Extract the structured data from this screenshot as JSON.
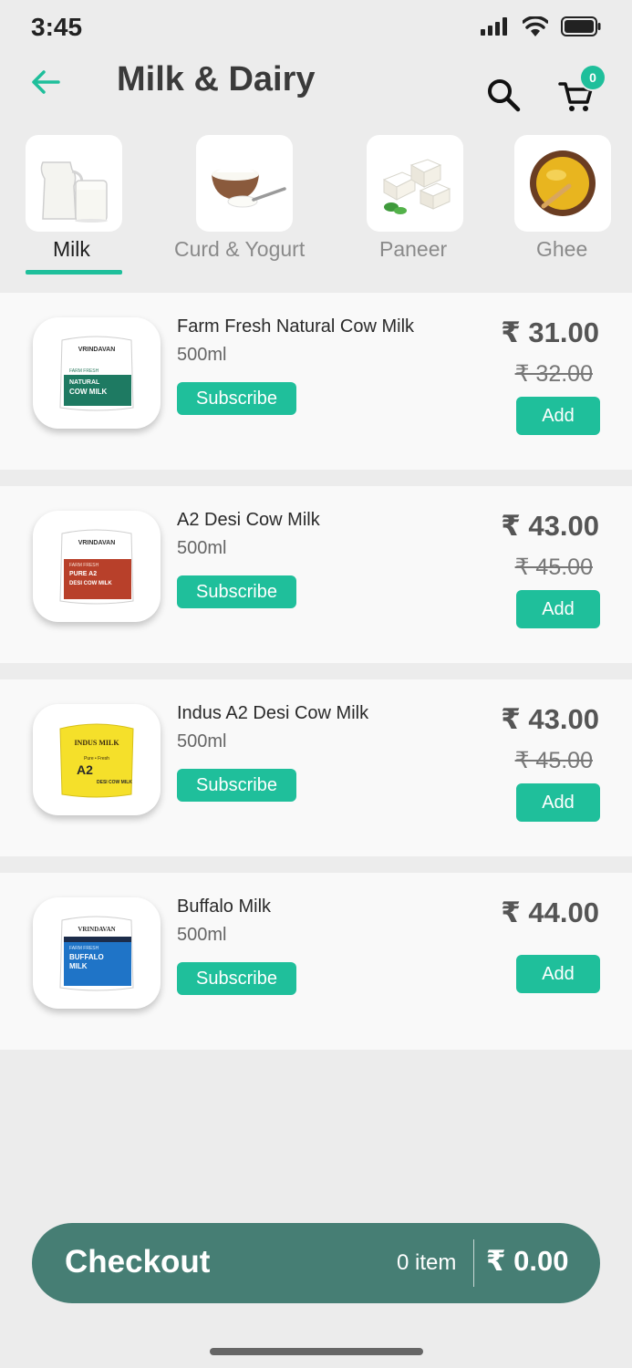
{
  "status_bar": {
    "time": "3:45"
  },
  "header": {
    "title": "Milk & Dairy",
    "cart_count": "0"
  },
  "categories": [
    {
      "label": "Milk",
      "icon": "milk-jug-and-glass",
      "active": true
    },
    {
      "label": "Curd & Yogurt",
      "icon": "curd-bowl-with-spoon",
      "active": false
    },
    {
      "label": "Paneer",
      "icon": "paneer-cubes",
      "active": false
    },
    {
      "label": "Ghee",
      "icon": "ghee-bowl",
      "active": false
    }
  ],
  "products": [
    {
      "name": "Farm Fresh Natural Cow Milk",
      "size": "500ml",
      "price": "₹ 31.00",
      "mrp": "₹ 32.00",
      "subscribe_label": "Subscribe",
      "add_label": "Add",
      "pack": {
        "brand": "VRINDAVAN",
        "line1": "FARM FRESH",
        "line2": "NATURAL",
        "line3": "COW MILK",
        "color": "#1e7a62"
      }
    },
    {
      "name": "A2 Desi Cow Milk",
      "size": "500ml",
      "price": "₹ 43.00",
      "mrp": "₹ 45.00",
      "subscribe_label": "Subscribe",
      "add_label": "Add",
      "pack": {
        "brand": "VRINDAVAN",
        "line1": "FARM FRESH",
        "line2": "PURE A2",
        "line3": "DESI COW MILK",
        "color": "#b8402a"
      }
    },
    {
      "name": "Indus A2 Desi Cow Milk",
      "size": "500ml",
      "price": "₹ 43.00",
      "mrp": "₹ 45.00",
      "subscribe_label": "Subscribe",
      "add_label": "Add",
      "pack": {
        "brand": "INDUS MILK",
        "line1": "Pure • Fresh",
        "line2": "A2",
        "line3": "DESI COW MILK",
        "color": "#f5e02a"
      }
    },
    {
      "name": "Buffalo Milk",
      "size": "500ml",
      "price": "₹ 44.00",
      "mrp": "",
      "subscribe_label": "Subscribe",
      "add_label": "Add",
      "pack": {
        "brand": "VRINDAVAN",
        "line1": "FARM FRESH",
        "line2": "BUFFALO",
        "line3": "MILK",
        "color": "#1f74c7"
      }
    }
  ],
  "checkout": {
    "label": "Checkout",
    "count": "0 item",
    "total": "₹ 0.00"
  },
  "colors": {
    "accent": "#1fbf9b",
    "checkout_bg": "#467e74",
    "background": "#ececec"
  }
}
